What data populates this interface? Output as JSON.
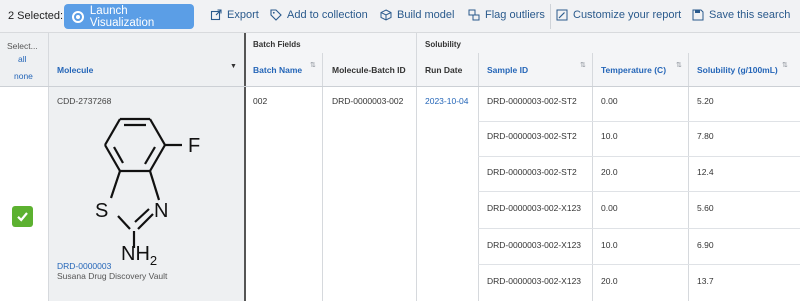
{
  "toolbar": {
    "selected_label": "2 Selected:",
    "launch_label": "Launch Visualization",
    "export_label": "Export",
    "add_collection_label": "Add to collection",
    "build_model_label": "Build model",
    "flag_outliers_label": "Flag outliers",
    "customize_label": "Customize your report",
    "save_search_label": "Save this search"
  },
  "select": {
    "label": "Select...",
    "all": "all",
    "none": "none"
  },
  "groups": {
    "batch_fields": "Batch Fields",
    "solubility": "Solubility"
  },
  "columns": {
    "molecule": "Molecule",
    "batch_name": "Batch Name",
    "molecule_batch_id": "Molecule-Batch ID",
    "run_date": "Run Date",
    "sample_id": "Sample ID",
    "temperature": "Temperature (C)",
    "solubility": "Solubility (g/100mL)"
  },
  "record": {
    "cdd_id": "CDD-2737268",
    "molecule_link": "DRD-0000003",
    "vault": "Susana Drug Discovery Vault",
    "batch_name": "002",
    "molecule_batch_id": "DRD-0000003-002",
    "run_date": "2023-10-04",
    "structure_labels": {
      "f": "F",
      "s": "S",
      "n": "N",
      "nh2": "NH",
      "sub2": "2"
    }
  },
  "rows": [
    {
      "sample_id": "DRD-0000003-002-ST2",
      "temperature": "0.00",
      "solubility": "5.20"
    },
    {
      "sample_id": "DRD-0000003-002-ST2",
      "temperature": "10.0",
      "solubility": "7.80"
    },
    {
      "sample_id": "DRD-0000003-002-ST2",
      "temperature": "20.0",
      "solubility": "12.4"
    },
    {
      "sample_id": "DRD-0000003-002-X123",
      "temperature": "0.00",
      "solubility": "5.60"
    },
    {
      "sample_id": "DRD-0000003-002-X123",
      "temperature": "10.0",
      "solubility": "6.90"
    },
    {
      "sample_id": "DRD-0000003-002-X123",
      "temperature": "20.0",
      "solubility": "13.7"
    }
  ],
  "colors": {
    "accent": "#5b9ee6",
    "link": "#2566b8",
    "check": "#5cb130"
  }
}
